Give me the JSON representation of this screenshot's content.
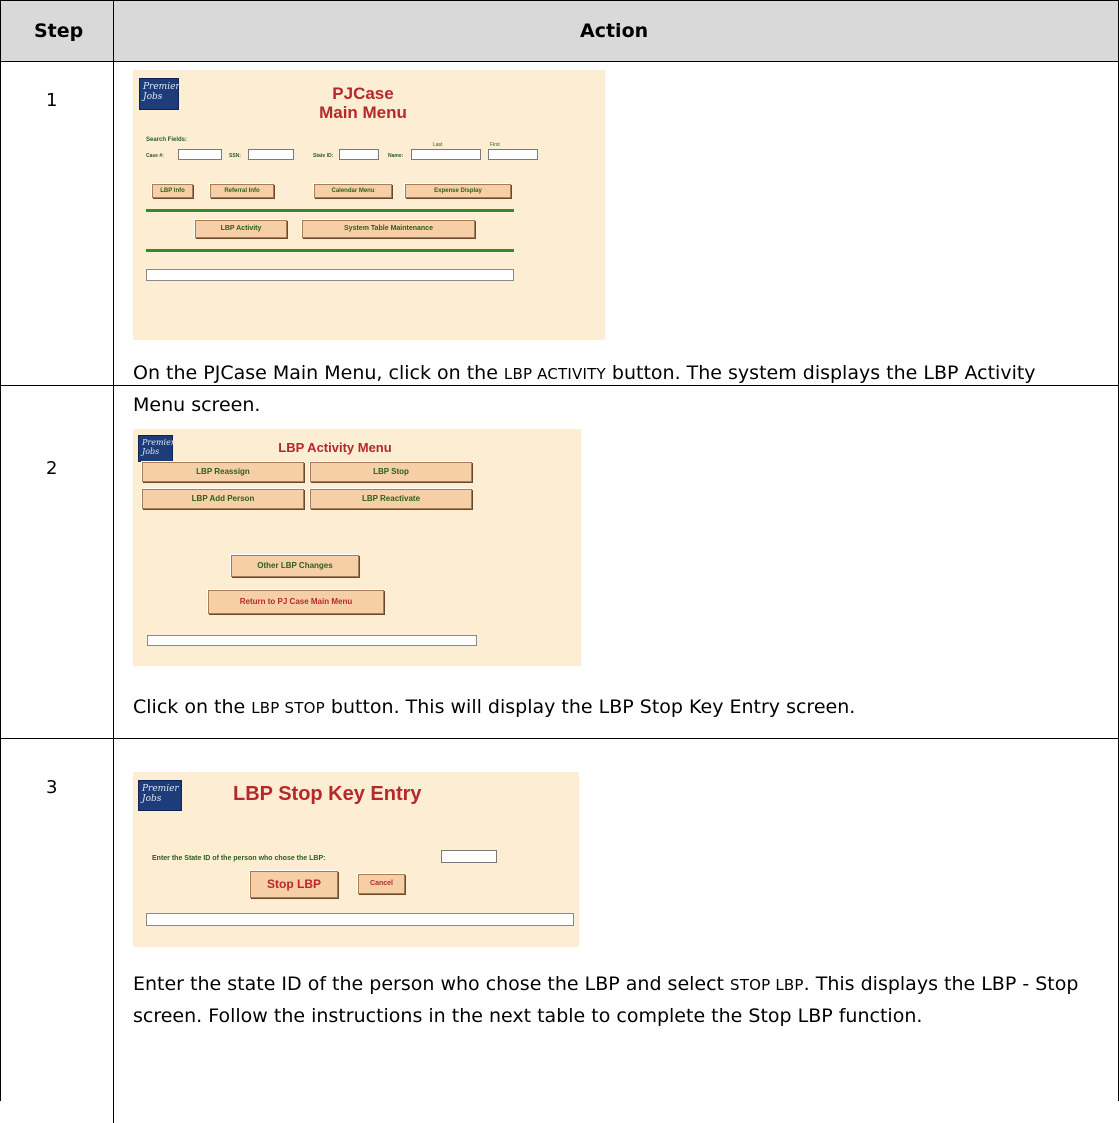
{
  "header": {
    "step": "Step",
    "action": "Action"
  },
  "rows": [
    {
      "step": "1",
      "text_before": "On the PJCase Main Menu, click on the ",
      "keyword": "LBP ACTIVITY",
      "text_after": " button. The system displays the LBP Activity Menu screen.",
      "screen": {
        "logo": "Premier Jobs",
        "title_line1": "PJCase",
        "title_line2": "Main Menu",
        "search_label": "Search Fields:",
        "case_label": "Case #:",
        "ssn_label": "SSN:",
        "state_id_label": "State ID:",
        "name_label": "Name:",
        "last_label": "Last",
        "first_label": "First",
        "buttons_row1": [
          "LBP Info",
          "Referral Info",
          "Calendar Menu",
          "Expense Display"
        ],
        "buttons_row2": [
          "LBP Activity",
          "System Table Maintenance"
        ]
      }
    },
    {
      "step": "2",
      "text_before": "Click on the ",
      "keyword": "LBP STOP",
      "text_after": " button. This will display the LBP Stop Key Entry screen.",
      "screen": {
        "logo": "Premier Jobs",
        "title": "LBP Activity Menu",
        "btn_reassign": "LBP Reassign",
        "btn_stop": "LBP Stop",
        "btn_add_person": "LBP Add Person",
        "btn_reactivate": "LBP Reactivate",
        "btn_other": "Other LBP Changes",
        "btn_return": "Return to PJ Case Main Menu"
      }
    },
    {
      "step": "3",
      "text_before": "Enter the state ID of the person who chose the LBP and select ",
      "keyword": "STOP LBP",
      "text_after": ". This displays the LBP - Stop screen. Follow the instructions in the next table to complete the Stop LBP function.",
      "screen": {
        "logo": "Premier Jobs",
        "title": "LBP Stop Key Entry",
        "prompt": "Enter the State ID of the person who chose the LBP:",
        "btn_stop": "Stop LBP",
        "btn_cancel": "Cancel"
      }
    }
  ],
  "colors": {
    "header_bg": "#d9d9d9",
    "screen_bg": "#fcedd3",
    "title_red": "#b5282b",
    "label_green": "#2a5f1c",
    "button_bg": "#f7cfa6"
  }
}
